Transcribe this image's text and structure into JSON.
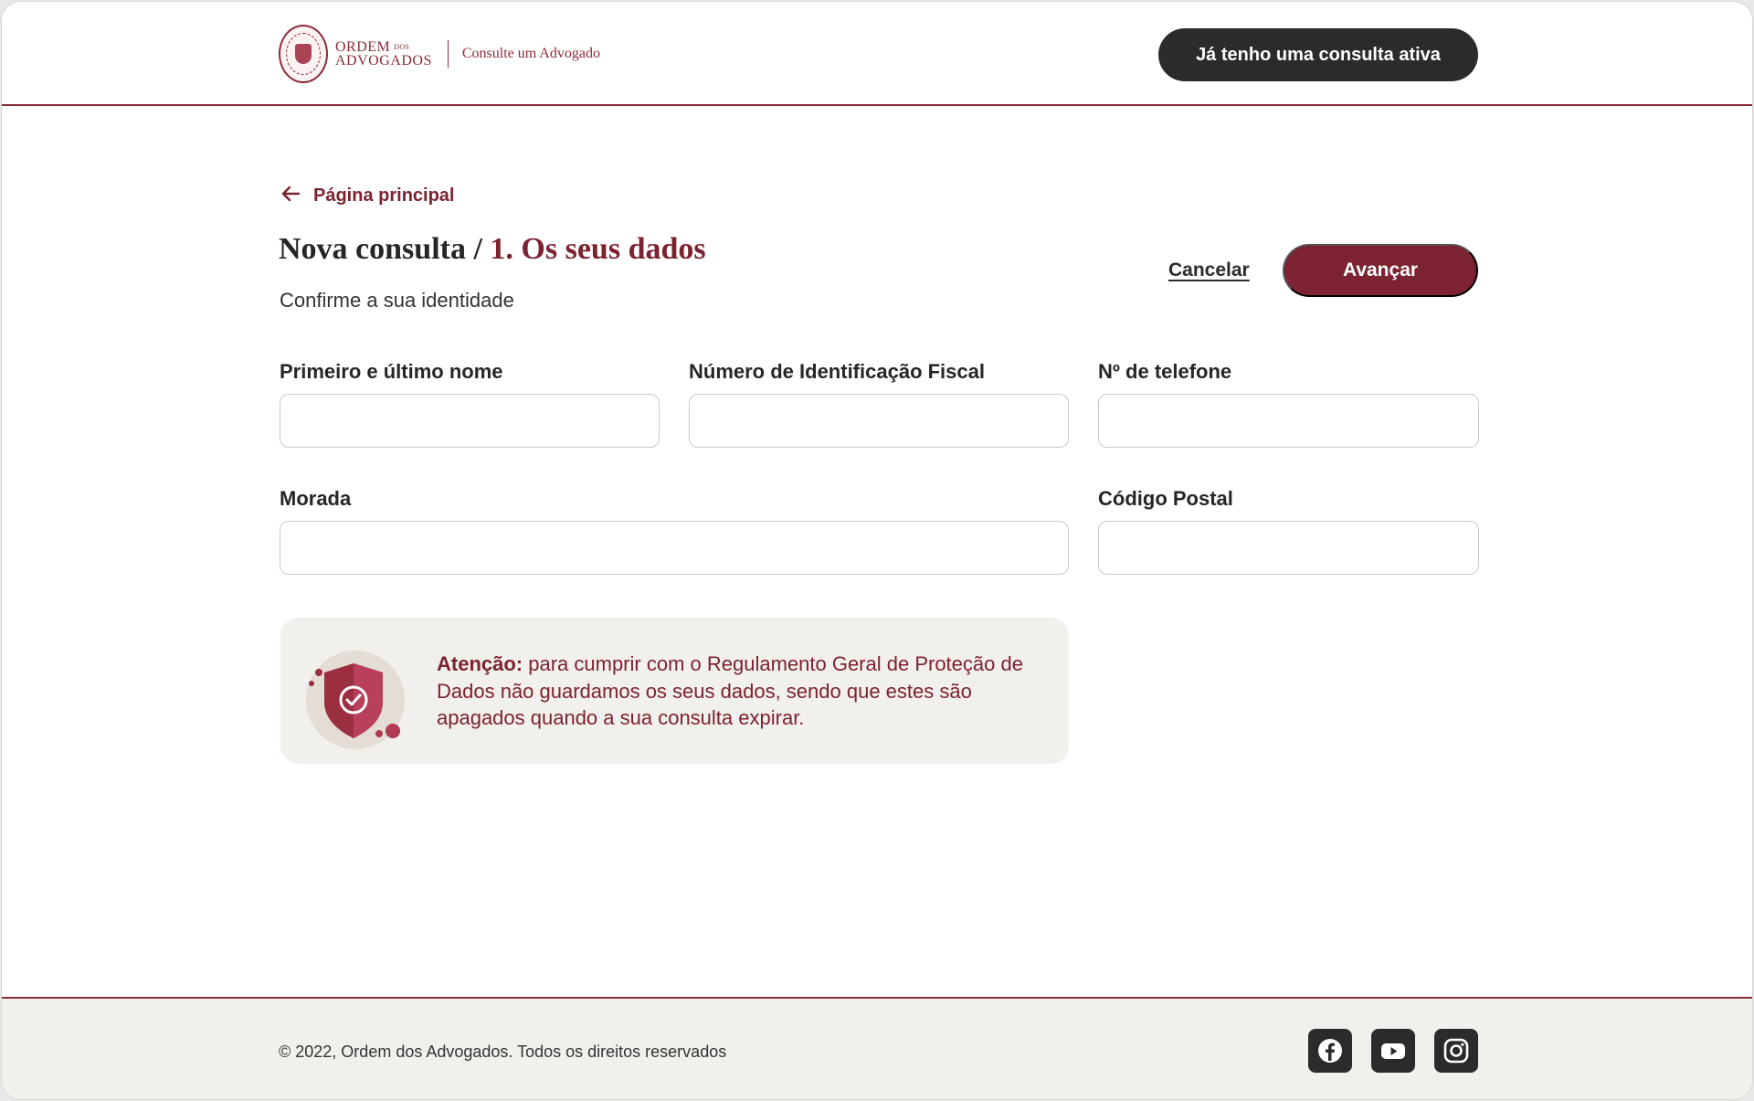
{
  "header": {
    "logo_line1": "ORDEM",
    "logo_line1_small": "DOS",
    "logo_line2": "ADVOGADOS",
    "logo_subtitle": "Consulte um Advogado",
    "active_consult_button": "Já tenho uma consulta ativa"
  },
  "nav": {
    "back_label": "Página principal"
  },
  "page": {
    "title_prefix": "Nova consulta / ",
    "title_step": "1. Os seus dados",
    "subtitle": "Confirme a sua identidade",
    "cancel_label": "Cancelar",
    "next_label": "Avançar"
  },
  "form": {
    "name_label": "Primeiro e último nome",
    "name_value": "",
    "nif_label": "Número de Identificação Fiscal",
    "nif_value": "",
    "phone_label": "Nº de telefone",
    "phone_value": "",
    "address_label": "Morada",
    "address_value": "",
    "postal_label": "Código Postal",
    "postal_value": ""
  },
  "notice": {
    "bold": "Atenção:",
    "text": " para cumprir com o Regulamento Geral de Proteção de Dados não guardamos os seus dados, sendo que estes são apagados quando a sua consulta expirar.",
    "icon": "shield-check-icon"
  },
  "footer": {
    "copyright": "© 2022, Ordem dos Advogados. Todos os direitos reservados",
    "social": [
      "facebook-icon",
      "youtube-icon",
      "instagram-icon"
    ]
  },
  "colors": {
    "brand": "#7c2230",
    "dark_button": "#2b2b2b",
    "notice_bg": "#f2f0ec"
  }
}
